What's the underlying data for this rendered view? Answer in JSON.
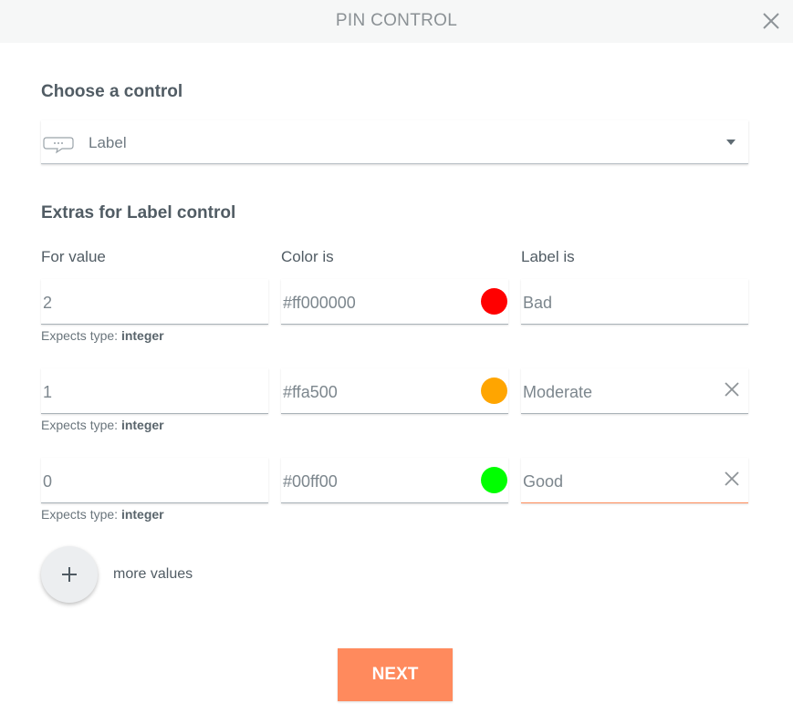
{
  "dialog": {
    "title": "PIN CONTROL"
  },
  "choose_section": {
    "title": "Choose a control",
    "selected_value": "Label",
    "icon": "speech-bubble-icon"
  },
  "extras_section": {
    "title": "Extras for Label control",
    "columns": {
      "value": "For value",
      "color": "Color is",
      "label": "Label is"
    },
    "hint_prefix": "Expects type: ",
    "hint_type": "integer",
    "rows": [
      {
        "value": "2",
        "color": "#ff000000",
        "swatch": "#ff0000",
        "label": "Bad"
      },
      {
        "value": "1",
        "color": "#ffa500",
        "swatch": "#ffa500",
        "label": "Moderate"
      },
      {
        "value": "0",
        "color": "#00ff00",
        "swatch": "#00ff00",
        "label": "Good"
      }
    ]
  },
  "more_values": {
    "label": "more values"
  },
  "next_button": {
    "label": "NEXT"
  },
  "colors": {
    "accent": "#ff8a5d",
    "header_bg": "#f6f7f7"
  }
}
